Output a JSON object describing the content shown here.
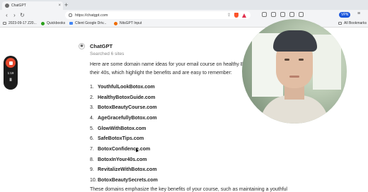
{
  "browser": {
    "tab_title": "ChatGPT",
    "tab_close": "×",
    "new_tab": "+",
    "url": "https://chatgpt.com",
    "vpn_label": "VPN",
    "nav": {
      "back": "‹",
      "forward": "›",
      "reload": "↻"
    },
    "menu": "≡"
  },
  "bookmarks": {
    "items": [
      {
        "label": "2023-09-17 Z20..."
      },
      {
        "label": "Quickbooks"
      },
      {
        "label": "Client Google Driv..."
      },
      {
        "label": "NitsGPT Input"
      }
    ],
    "all_label": "All Bookmarks"
  },
  "chat": {
    "avatar_glyph": "✺",
    "assistant_name": "ChatGPT",
    "searched": "Searched 6 sites",
    "intro": "Here are some domain name ideas for your email course on healthy Botox in their 40s, which highlight the benefits and are easy to remember:",
    "domains": [
      {
        "num": "1.",
        "name": "YouthfulLookBotox.com"
      },
      {
        "num": "2.",
        "name": "HealthyBotoxGuide.com"
      },
      {
        "num": "3.",
        "name": "BotoxBeautyCourse.com"
      },
      {
        "num": "4.",
        "name": "AgeGracefullyBotox.com"
      },
      {
        "num": "5.",
        "name": "GlowWithBotox.com"
      },
      {
        "num": "6.",
        "name": "SafeBotoxTips.com"
      },
      {
        "num": "7.",
        "name": "BotoxConfidence.com"
      },
      {
        "num": "8.",
        "name": "BotoxInYour40s.com"
      },
      {
        "num": "9.",
        "name": "RevitalizeWithBotox.com"
      },
      {
        "num": "10.",
        "name": "BotoxBeautySecrets.com"
      }
    ],
    "closing": "These domains emphasize the key benefits of your course, such as maintaining a youthful"
  },
  "recorder": {
    "time": "1:19",
    "pause": "II",
    "stop_color": "#e5482d"
  },
  "colors": {
    "accent_vpn": "#1a56db",
    "brave": "#fb542b"
  }
}
